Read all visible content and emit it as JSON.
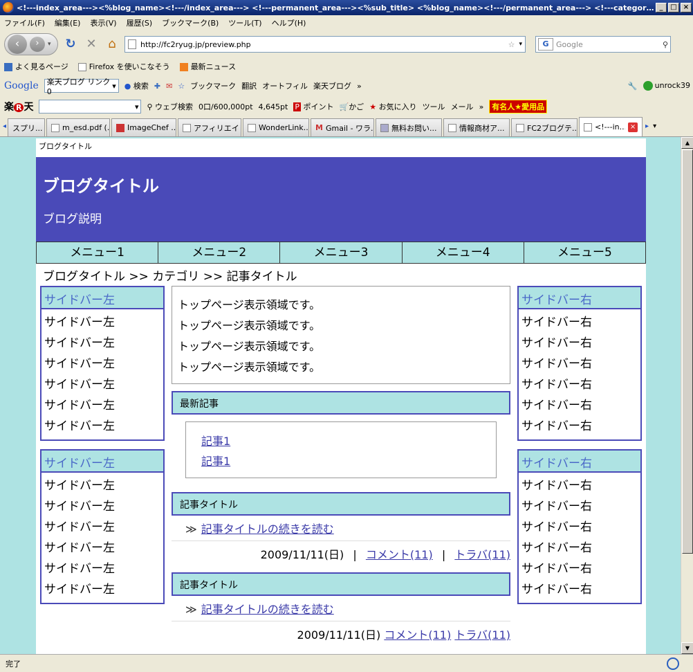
{
  "window": {
    "title": "<!---index_area---><%blog_name><!---/index_area---> <!---permanent_area---><%sub_title> <%blog_name><!---/permanent_area---> <!---category_area---><%..."
  },
  "menubar": [
    "ファイル(F)",
    "編集(E)",
    "表示(V)",
    "履歴(S)",
    "ブックマーク(B)",
    "ツール(T)",
    "ヘルプ(H)"
  ],
  "nav": {
    "url": "http://fc2ryug.jp/preview.php",
    "search_placeholder": "Google"
  },
  "bookmarks": [
    "よく見るページ",
    "Firefox を使いこなそう",
    "最新ニュース"
  ],
  "google_toolbar": {
    "logo": "Google",
    "combo": "楽天ブログ リンク0",
    "items": [
      "検索",
      "ブックマーク",
      "翻訳",
      "オートフィル",
      "楽天ブログ",
      "»"
    ],
    "user": "unrock39"
  },
  "rakuten_toolbar": {
    "logo_a": "楽",
    "logo_r": "R",
    "logo_b": "天",
    "items": [
      "ウェブ検索",
      "0口/600,000pt",
      "4,645pt",
      "ポイント",
      "かご",
      "お気に入り",
      "ツール",
      "メール",
      "»"
    ],
    "badge": "有名人★愛用品"
  },
  "tabs": [
    {
      "label": "スプリ...",
      "active": false
    },
    {
      "label": "m_esd.pdf (...",
      "active": false
    },
    {
      "label": "ImageChef ...",
      "active": false
    },
    {
      "label": "アフィリエイト...",
      "active": false
    },
    {
      "label": "WonderLink...",
      "active": false
    },
    {
      "label": "Gmail - ワラ...",
      "active": false
    },
    {
      "label": "無料お問い...",
      "active": false
    },
    {
      "label": "情報商材ア...",
      "active": false
    },
    {
      "label": "FC2ブログテ...",
      "active": false
    },
    {
      "label": "<!---in...",
      "active": true
    }
  ],
  "blog": {
    "top_label": "ブログタイトル",
    "title": "ブログタイトル",
    "description": "ブログ説明",
    "menus": [
      "メニュー1",
      "メニュー2",
      "メニュー3",
      "メニュー4",
      "メニュー5"
    ],
    "breadcrumb": "ブログタイトル >> カテゴリ >> 記事タイトル",
    "sidebar_left": [
      {
        "title": "サイドバー左",
        "items": [
          "サイドバー左",
          "サイドバー左",
          "サイドバー左",
          "サイドバー左",
          "サイドバー左",
          "サイドバー左"
        ]
      },
      {
        "title": "サイドバー左",
        "items": [
          "サイドバー左",
          "サイドバー左",
          "サイドバー左",
          "サイドバー左",
          "サイドバー左",
          "サイドバー左"
        ]
      }
    ],
    "sidebar_right": [
      {
        "title": "サイドバー右",
        "items": [
          "サイドバー右",
          "サイドバー右",
          "サイドバー右",
          "サイドバー右",
          "サイドバー右",
          "サイドバー右"
        ]
      },
      {
        "title": "サイドバー右",
        "items": [
          "サイドバー右",
          "サイドバー右",
          "サイドバー右",
          "サイドバー右",
          "サイドバー右",
          "サイドバー右"
        ]
      }
    ],
    "top_lines": [
      "トップページ表示領域です。",
      "トップページ表示領域です。",
      "トップページ表示領域です。",
      "トップページ表示領域です。"
    ],
    "latest_heading": "最新記事",
    "latest_links": [
      "記事1",
      "記事1"
    ],
    "entries": [
      {
        "title": "記事タイトル",
        "mark": "≫",
        "readmore": "記事タイトルの続きを読む",
        "date": "2009/11/11(日)",
        "comment": "コメント(11)",
        "trackback": "トラバ(11)",
        "sep": "|"
      },
      {
        "title": "記事タイトル",
        "mark": "≫",
        "readmore": "記事タイトルの続きを読む",
        "date": "2009/11/11(日)",
        "comment": "コメント(11)",
        "trackback": "トラバ(11)",
        "sep": ""
      }
    ]
  },
  "status": "完了",
  "colors": {
    "header_bg": "#4a4ab8",
    "page_bg": "#aee3e3",
    "link": "#3a3aa8"
  }
}
